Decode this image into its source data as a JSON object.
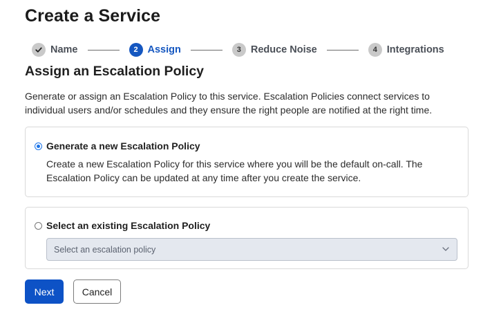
{
  "page": {
    "title": "Create a Service"
  },
  "stepper": {
    "steps": [
      {
        "number": "",
        "label": "Name",
        "state": "done",
        "icon": "check-icon"
      },
      {
        "number": "2",
        "label": "Assign",
        "state": "active"
      },
      {
        "number": "3",
        "label": "Reduce Noise",
        "state": "pending"
      },
      {
        "number": "4",
        "label": "Integrations",
        "state": "pending"
      }
    ]
  },
  "section": {
    "heading": "Assign an Escalation Policy",
    "intro": "Generate or assign an Escalation Policy to this service. Escalation Policies connect services to individual users and/or schedules and they ensure the right people are notified at the right time."
  },
  "options": {
    "generate": {
      "label": "Generate a new Escalation Policy",
      "description": "Create a new Escalation Policy for this service where you will be the default on-call. The Escalation Policy can be updated at any time after you create the service.",
      "selected": true
    },
    "existing": {
      "label": "Select an existing Escalation Policy",
      "selected": false,
      "select_placeholder": "Select an escalation policy",
      "icon": "chevron-down-icon"
    }
  },
  "actions": {
    "next_label": "Next",
    "cancel_label": "Cancel"
  },
  "colors": {
    "primary": "#0d52c6",
    "active_step": "#1557c0",
    "radio_checked": "#1a73e8",
    "select_bg": "#e4e8ef"
  }
}
